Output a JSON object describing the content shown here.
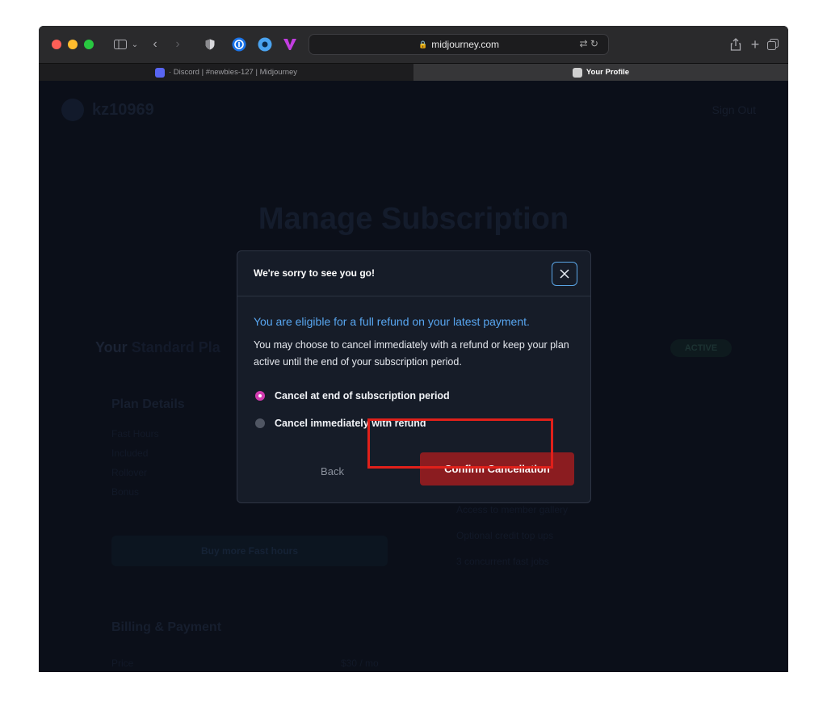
{
  "browser": {
    "url": "midjourney.com",
    "tabs": [
      {
        "label": "· Discord | #newbies-127 | Midjourney",
        "active": false
      },
      {
        "label": "Your Profile",
        "active": true
      }
    ]
  },
  "page": {
    "username": "kz10969",
    "sign_out": "Sign Out",
    "title": "Manage Subscription",
    "plan_heading_prefix": "Your",
    "plan_heading_name": "Standard Pla",
    "active_badge": "ACTIVE",
    "plan_details_heading": "Plan Details",
    "plan_rows": [
      "Fast Hours",
      "Included",
      "Rollover",
      "Bonus"
    ],
    "buy_button": "Buy more Fast hours",
    "features": [
      "Access to member gallery",
      "Optional credit top ups",
      "3 concurrent fast jobs"
    ],
    "billing_heading": "Billing & Payment",
    "price_label": "Price",
    "price_value": "$30 / mo"
  },
  "modal": {
    "title": "We're sorry to see you go!",
    "refund_line": "You are eligible for a full refund on your latest payment.",
    "description": "You may choose to cancel immediately with a refund or keep your plan active until the end of your subscription period.",
    "options": [
      {
        "label": "Cancel at end of subscription period",
        "checked": true
      },
      {
        "label": "Cancel immediately with refund",
        "checked": false
      }
    ],
    "back_button": "Back",
    "confirm_button": "Confirm Cancellation"
  },
  "colors": {
    "accent_radio": "#d23bb0",
    "confirm_button": "#8b1c20",
    "refund_text": "#58a6f0",
    "highlight_box": "#e0201a"
  }
}
